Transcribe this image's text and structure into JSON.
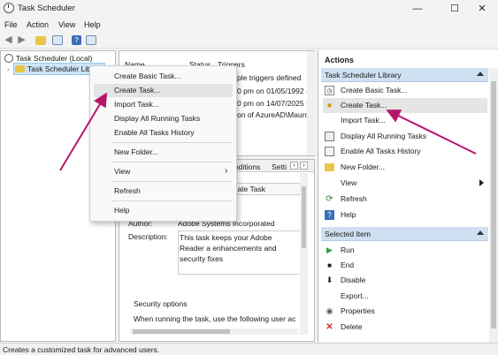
{
  "window": {
    "title": "Task Scheduler"
  },
  "window_controls": {
    "minimize": "—",
    "maximize": "☐",
    "close": "✕"
  },
  "menu": [
    "File",
    "Action",
    "View",
    "Help"
  ],
  "tree": {
    "root": "Task Scheduler (Local)",
    "child": "Task Scheduler Libra"
  },
  "task_list": {
    "columns": [
      "Name",
      "Status",
      "Triggers"
    ],
    "rows": [
      "ple triggers defined",
      "0 pm on 01/05/1992 - A",
      "0 pm on 14/07/2025 - A",
      "on of AzureAD\\Mauro"
    ]
  },
  "details": {
    "tabs": [
      "nditions",
      "Setti"
    ],
    "name_value": "odate Task",
    "author_label": "Author:",
    "author_value": "Adobe Systems Incorporated",
    "description_label": "Description:",
    "description_value": "This task keeps your Adobe Reader a enhancements and security fixes",
    "security_options_label": "Security options",
    "security_text": "When running the task, use the following user ac"
  },
  "context_menu": {
    "items": [
      "Create Basic Task...",
      "Create Task...",
      "Import Task...",
      "Display All Running Tasks",
      "Enable All Tasks History",
      "New Folder...",
      "View",
      "Refresh",
      "Help"
    ],
    "view_arrow": "›"
  },
  "actions": {
    "title": "Actions",
    "library_header": "Task Scheduler Library",
    "library_items": [
      "Create Basic Task...",
      "Create Task...",
      "Import Task...",
      "Display All Running Tasks",
      "Enable All Tasks History",
      "New Folder...",
      "View",
      "Refresh",
      "Help"
    ],
    "selected_header": "Selected Item",
    "selected_items": [
      "Run",
      "End",
      "Disable",
      "Export...",
      "Properties",
      "Delete"
    ]
  },
  "status_bar": "Creates a customized task for advanced users.",
  "colors": {
    "arrow": "#b5156b",
    "section_header": "#cfe0f2",
    "highlight": "#e3e3e3"
  }
}
